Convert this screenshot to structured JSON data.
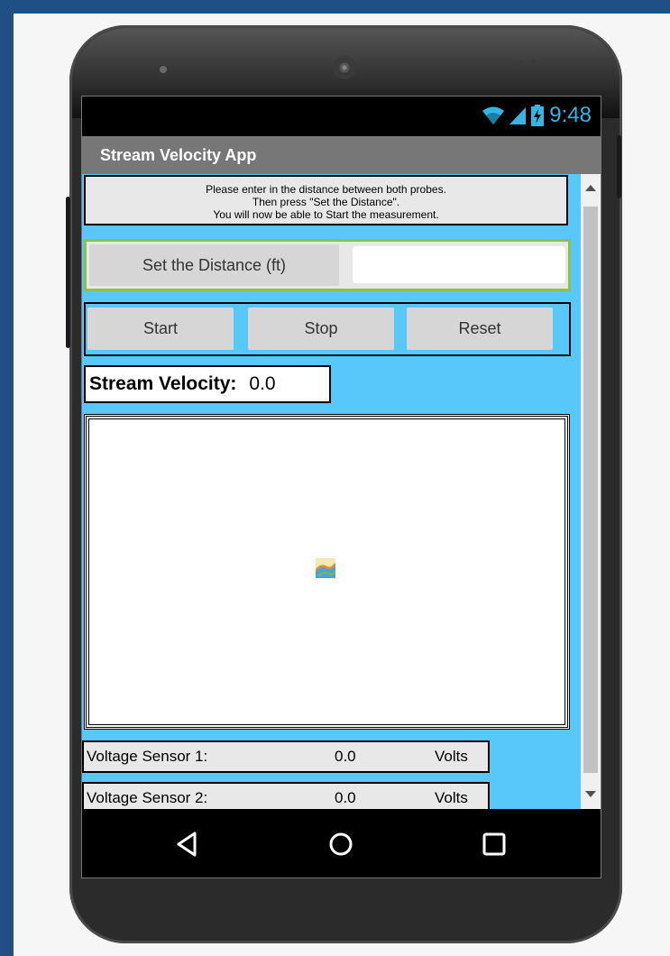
{
  "app": {
    "title": "Stream Velocity App"
  },
  "status_bar": {
    "time": "9:48",
    "icons": [
      "wifi-icon",
      "signal-icon",
      "battery-charging-icon"
    ],
    "accent_color": "#33b5e5"
  },
  "instructions": {
    "line1": "Please enter in the distance between both probes.",
    "line2": "Then press \"Set the Distance\".",
    "line3": "You will now be able to Start the measurement."
  },
  "distance": {
    "button_label": "Set the Distance (ft)",
    "input_value": ""
  },
  "controls": {
    "start_label": "Start",
    "stop_label": "Stop",
    "reset_label": "Reset"
  },
  "velocity": {
    "label": "Stream Velocity:",
    "value": "0.0"
  },
  "canvas": {
    "icon": "broken-image-icon"
  },
  "sensors": [
    {
      "label": "Voltage Sensor 1:",
      "value": "0.0",
      "unit": "Volts"
    },
    {
      "label": "Voltage Sensor 2:",
      "value": "0.0",
      "unit": "Volts"
    }
  ],
  "nav": {
    "icons": [
      "back-icon",
      "home-icon",
      "recents-icon"
    ]
  },
  "colors": {
    "content_background": "#58c8fb",
    "title_bar": "#777777",
    "distance_row_border": "#8bc34a"
  }
}
